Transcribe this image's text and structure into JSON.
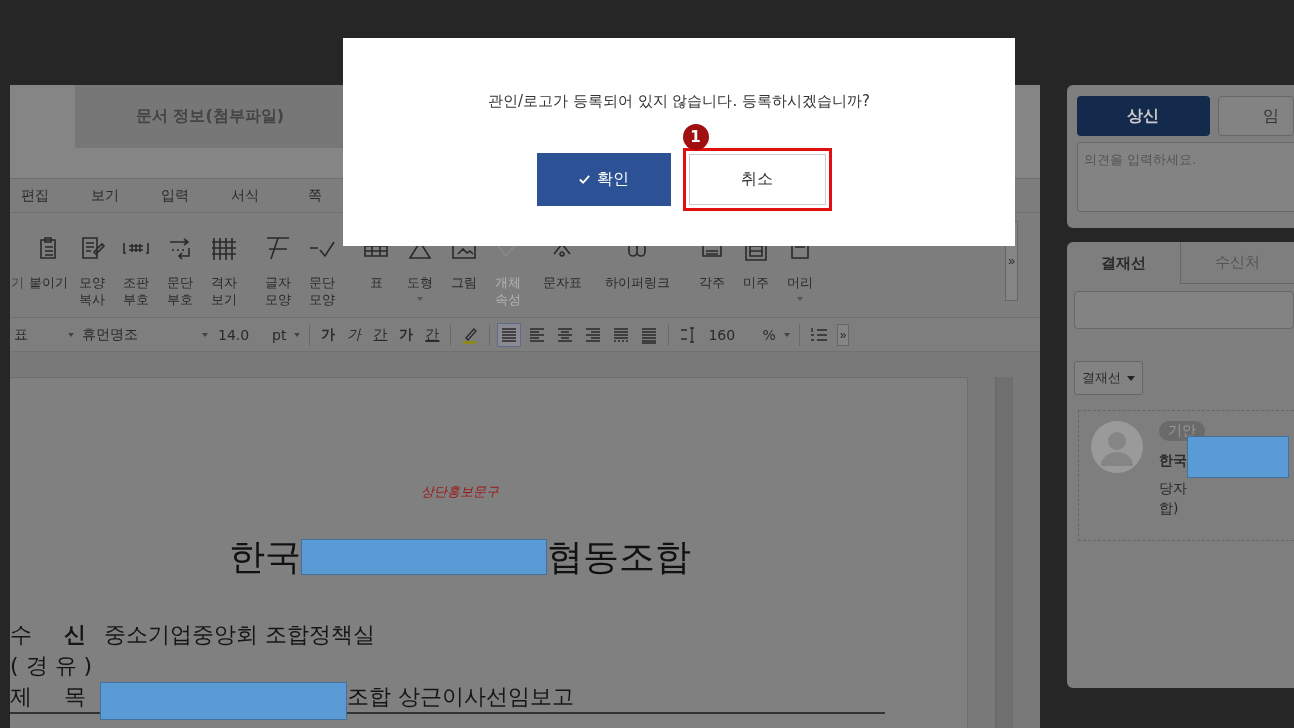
{
  "editor": {
    "tabs": [
      {
        "label": "문서 정보(첨부파일)",
        "selected": false
      }
    ],
    "menu": [
      "편집",
      "보기",
      "입력",
      "서식",
      "쪽"
    ],
    "ribbon": [
      {
        "label": "기",
        "kind": "none",
        "disabled": false,
        "dropdown": false
      },
      {
        "label": "붙이기",
        "kind": "paste",
        "disabled": false,
        "dropdown": false
      },
      {
        "label": "모양 복사",
        "kind": "format-copy",
        "disabled": false,
        "dropdown": false
      },
      {
        "label": "조판 부호",
        "kind": "markup",
        "disabled": false,
        "dropdown": false
      },
      {
        "label": "문단 부호",
        "kind": "para-mark",
        "disabled": false,
        "dropdown": false
      },
      {
        "label": "격자 보기",
        "kind": "grid",
        "disabled": false,
        "dropdown": false
      },
      {
        "label": "글자 모양",
        "kind": "char",
        "disabled": false,
        "dropdown": false
      },
      {
        "label": "문단 모양",
        "kind": "para",
        "disabled": false,
        "dropdown": false
      },
      {
        "label": "표",
        "kind": "table",
        "disabled": false,
        "dropdown": false
      },
      {
        "label": "도형",
        "kind": "shape",
        "disabled": false,
        "dropdown": true
      },
      {
        "label": "그림",
        "kind": "picture",
        "disabled": false,
        "dropdown": false
      },
      {
        "label": "개체 속성",
        "kind": "object",
        "disabled": true,
        "dropdown": false
      },
      {
        "label": "문자표",
        "kind": "symbol",
        "disabled": false,
        "dropdown": false
      },
      {
        "label": "하이퍼링크",
        "kind": "link",
        "disabled": false,
        "dropdown": false
      },
      {
        "label": "각주",
        "kind": "footnote",
        "disabled": false,
        "dropdown": false
      },
      {
        "label": "미주",
        "kind": "endnote",
        "disabled": false,
        "dropdown": false
      },
      {
        "label": "머리",
        "kind": "header",
        "disabled": false,
        "dropdown": true
      }
    ],
    "ribbon_more": "»",
    "format_bar": {
      "style": "표",
      "font": "휴먼명조",
      "size": "14.0",
      "unit": "pt",
      "text_styles": [
        {
          "label": "가",
          "kind": "bold"
        },
        {
          "label": "가",
          "kind": "italic"
        },
        {
          "label": "간",
          "kind": "underline"
        },
        {
          "label": "가",
          "kind": "strike"
        },
        {
          "label": "간",
          "kind": "color"
        }
      ],
      "align": [
        {
          "kind": "justify",
          "selected": true
        },
        {
          "kind": "left",
          "selected": false
        },
        {
          "kind": "center",
          "selected": false
        },
        {
          "kind": "right",
          "selected": false
        },
        {
          "kind": "distribute",
          "selected": false
        },
        {
          "kind": "divide",
          "selected": false
        }
      ],
      "line_spacing": "160",
      "spacing_unit": "%",
      "more": "»"
    },
    "document": {
      "header_phrase": "상단홍보문구",
      "title": {
        "before": "한국",
        "after": "협동조합",
        "redacted": true
      },
      "fields": [
        {
          "label": "수",
          "label2": "신",
          "value": "중소기업중앙회  조합정책실",
          "redacted": false
        },
        {
          "label": "( 경 유 )",
          "redacted": false
        },
        {
          "label": "제",
          "label2": "목",
          "value": "조합  상근이사선임보고",
          "redacted": true
        }
      ]
    }
  },
  "dialog": {
    "message": "관인/로고가 등록되어 있지 않습니다. 등록하시겠습니까?",
    "confirm": "확인",
    "cancel": "취소",
    "marker": "1"
  },
  "side": {
    "submit": "상신",
    "second_button": "임",
    "comment": {
      "placeholder": "의견을 입력하세요."
    },
    "tabs": [
      {
        "label": "결재선",
        "selected": true
      },
      {
        "label": "수신처",
        "selected": false
      }
    ],
    "line_select": "결재선",
    "approver": {
      "role": "기안",
      "name": "한국",
      "line2": "당자",
      "line3": "합)",
      "redacted": true
    }
  }
}
